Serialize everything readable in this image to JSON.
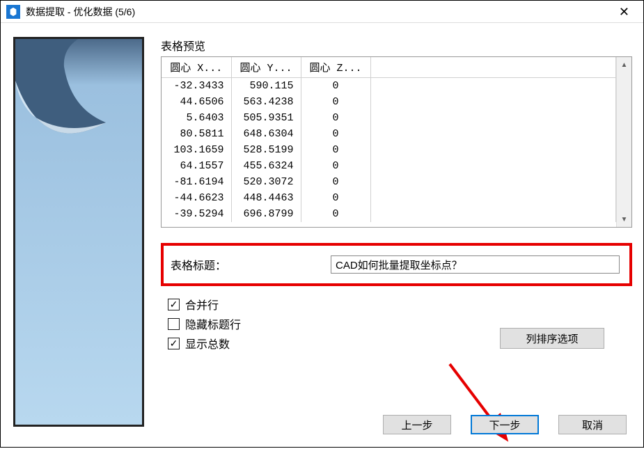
{
  "window": {
    "title": "数据提取 - 优化数据 (5/6)"
  },
  "preview": {
    "label": "表格预览",
    "columns": [
      "圆心 X...",
      "圆心 Y...",
      "圆心 Z..."
    ],
    "rows": [
      {
        "x": "-32.3433",
        "y": "590.115",
        "z": "0"
      },
      {
        "x": "44.6506",
        "y": "563.4238",
        "z": "0"
      },
      {
        "x": "5.6403",
        "y": "505.9351",
        "z": "0"
      },
      {
        "x": "80.5811",
        "y": "648.6304",
        "z": "0"
      },
      {
        "x": "103.1659",
        "y": "528.5199",
        "z": "0"
      },
      {
        "x": "64.1557",
        "y": "455.6324",
        "z": "0"
      },
      {
        "x": "-81.6194",
        "y": "520.3072",
        "z": "0"
      },
      {
        "x": "-44.6623",
        "y": "448.4463",
        "z": "0"
      },
      {
        "x": "-39.5294",
        "y": "696.8799",
        "z": "0"
      }
    ]
  },
  "titleRow": {
    "label": "表格标题：",
    "value": "CAD如何批量提取坐标点？"
  },
  "options": {
    "mergeRows": {
      "label": "合并行",
      "checked": true
    },
    "hideHeader": {
      "label": "隐藏标题行",
      "checked": false
    },
    "showTotals": {
      "label": "显示总数",
      "checked": true
    }
  },
  "buttons": {
    "columnSort": "列排序选项",
    "prev": "上一步",
    "next": "下一步",
    "cancel": "取消"
  }
}
